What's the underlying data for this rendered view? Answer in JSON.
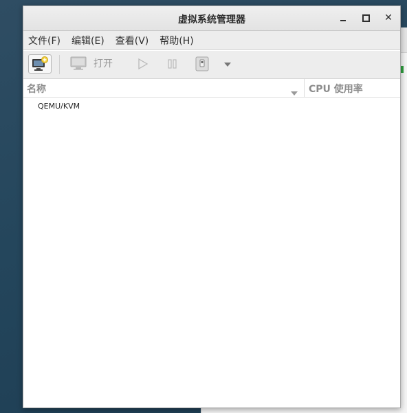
{
  "window": {
    "title": "虚拟系统管理器"
  },
  "menubar": {
    "items": [
      "文件(F)",
      "编辑(E)",
      "查看(V)",
      "帮助(H)"
    ]
  },
  "toolbar": {
    "open_label": "打开"
  },
  "table": {
    "columns": [
      "名称",
      "CPU 使用率"
    ],
    "rows": [
      {
        "name": "QEMU/KVM"
      }
    ]
  }
}
